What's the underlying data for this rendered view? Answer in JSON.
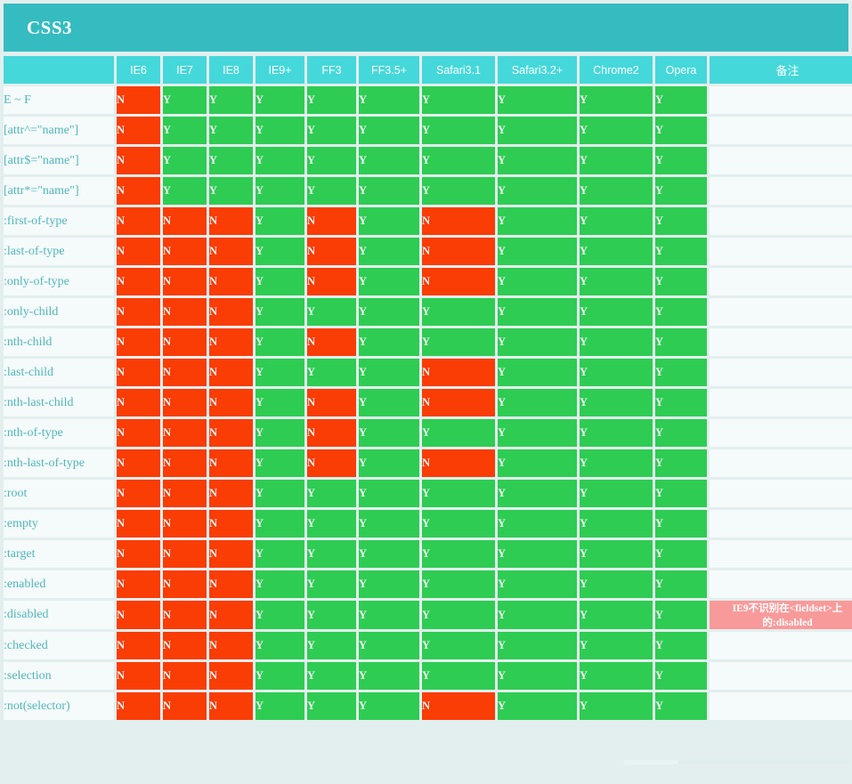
{
  "header": {
    "title": "CSS3"
  },
  "table": {
    "columns": [
      {
        "key": "selector",
        "label": ""
      },
      {
        "key": "ie6",
        "label": "IE6"
      },
      {
        "key": "ie7",
        "label": "IE7"
      },
      {
        "key": "ie8",
        "label": "IE8"
      },
      {
        "key": "ie9",
        "label": "IE9+"
      },
      {
        "key": "ff3",
        "label": "FF3"
      },
      {
        "key": "ff35",
        "label": "FF3.5+"
      },
      {
        "key": "safari31",
        "label": "Safari3.1"
      },
      {
        "key": "safari32",
        "label": "Safari3.2+"
      },
      {
        "key": "chrome2",
        "label": "Chrome2"
      },
      {
        "key": "opera",
        "label": "Opera"
      },
      {
        "key": "note",
        "label": "备注"
      }
    ],
    "yes_label": "Y",
    "no_label": "N",
    "rows": [
      {
        "selector": "E ~ F",
        "values": [
          "N",
          "Y",
          "Y",
          "Y",
          "Y",
          "Y",
          "Y",
          "Y",
          "Y",
          "Y"
        ],
        "note": ""
      },
      {
        "selector": "[attr^=\"name\"]",
        "values": [
          "N",
          "Y",
          "Y",
          "Y",
          "Y",
          "Y",
          "Y",
          "Y",
          "Y",
          "Y"
        ],
        "note": ""
      },
      {
        "selector": "[attr$=\"name\"]",
        "values": [
          "N",
          "Y",
          "Y",
          "Y",
          "Y",
          "Y",
          "Y",
          "Y",
          "Y",
          "Y"
        ],
        "note": ""
      },
      {
        "selector": "[attr*=\"name\"]",
        "values": [
          "N",
          "Y",
          "Y",
          "Y",
          "Y",
          "Y",
          "Y",
          "Y",
          "Y",
          "Y"
        ],
        "note": ""
      },
      {
        "selector": ":first-of-type",
        "values": [
          "N",
          "N",
          "N",
          "Y",
          "N",
          "Y",
          "N",
          "Y",
          "Y",
          "Y"
        ],
        "note": ""
      },
      {
        "selector": ":last-of-type",
        "values": [
          "N",
          "N",
          "N",
          "Y",
          "N",
          "Y",
          "N",
          "Y",
          "Y",
          "Y"
        ],
        "note": ""
      },
      {
        "selector": ":only-of-type",
        "values": [
          "N",
          "N",
          "N",
          "Y",
          "N",
          "Y",
          "N",
          "Y",
          "Y",
          "Y"
        ],
        "note": ""
      },
      {
        "selector": ":only-child",
        "values": [
          "N",
          "N",
          "N",
          "Y",
          "Y",
          "Y",
          "Y",
          "Y",
          "Y",
          "Y"
        ],
        "note": ""
      },
      {
        "selector": ":nth-child",
        "values": [
          "N",
          "N",
          "N",
          "Y",
          "N",
          "Y",
          "Y",
          "Y",
          "Y",
          "Y"
        ],
        "note": ""
      },
      {
        "selector": ":last-child",
        "values": [
          "N",
          "N",
          "N",
          "Y",
          "Y",
          "Y",
          "N",
          "Y",
          "Y",
          "Y"
        ],
        "note": ""
      },
      {
        "selector": ":nth-last-child",
        "values": [
          "N",
          "N",
          "N",
          "Y",
          "N",
          "Y",
          "N",
          "Y",
          "Y",
          "Y"
        ],
        "note": ""
      },
      {
        "selector": ":nth-of-type",
        "values": [
          "N",
          "N",
          "N",
          "Y",
          "N",
          "Y",
          "Y",
          "Y",
          "Y",
          "Y"
        ],
        "note": ""
      },
      {
        "selector": ":nth-last-of-type",
        "values": [
          "N",
          "N",
          "N",
          "Y",
          "N",
          "Y",
          "N",
          "Y",
          "Y",
          "Y"
        ],
        "note": ""
      },
      {
        "selector": ":root",
        "values": [
          "N",
          "N",
          "N",
          "Y",
          "Y",
          "Y",
          "Y",
          "Y",
          "Y",
          "Y"
        ],
        "note": ""
      },
      {
        "selector": ":empty",
        "values": [
          "N",
          "N",
          "N",
          "Y",
          "Y",
          "Y",
          "Y",
          "Y",
          "Y",
          "Y"
        ],
        "note": ""
      },
      {
        "selector": ":target",
        "values": [
          "N",
          "N",
          "N",
          "Y",
          "Y",
          "Y",
          "Y",
          "Y",
          "Y",
          "Y"
        ],
        "note": ""
      },
      {
        "selector": ":enabled",
        "values": [
          "N",
          "N",
          "N",
          "Y",
          "Y",
          "Y",
          "Y",
          "Y",
          "Y",
          "Y"
        ],
        "note": ""
      },
      {
        "selector": ":disabled",
        "values": [
          "N",
          "N",
          "N",
          "Y",
          "Y",
          "Y",
          "Y",
          "Y",
          "Y",
          "Y"
        ],
        "note": "IE9不识别在<fieldset>上的:disabled"
      },
      {
        "selector": ":checked",
        "values": [
          "N",
          "N",
          "N",
          "Y",
          "Y",
          "Y",
          "Y",
          "Y",
          "Y",
          "Y"
        ],
        "note": ""
      },
      {
        "selector": ":selection",
        "values": [
          "N",
          "N",
          "N",
          "Y",
          "Y",
          "Y",
          "Y",
          "Y",
          "Y",
          "Y"
        ],
        "note": ""
      },
      {
        "selector": ":not(selector)",
        "values": [
          "N",
          "N",
          "N",
          "Y",
          "Y",
          "Y",
          "N",
          "Y",
          "Y",
          "Y"
        ],
        "note": ""
      }
    ]
  },
  "colors": {
    "title_bar": "#35bcc0",
    "column_header": "#45d8da",
    "supported": "#2ecc52",
    "unsupported": "#fa3c05",
    "cell_background": "#f5fafa",
    "page_background": "#e3eeee",
    "note_background": "#f99a9a",
    "selector_text": "#4fb7bd"
  },
  "scrollbar": {
    "orientation": "horizontal",
    "position": "bottom"
  }
}
